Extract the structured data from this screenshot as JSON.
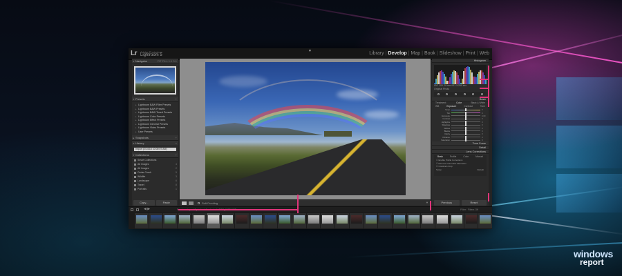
{
  "app": {
    "logo": "Lr",
    "brand_small": "Adobe Photoshop",
    "brand_name": "Lightroom 5"
  },
  "modules": [
    "Library",
    "Develop",
    "Map",
    "Book",
    "Slideshow",
    "Print",
    "Web"
  ],
  "active_module": "Develop",
  "left_panel": {
    "navigator": {
      "title": "Navigator",
      "zoom": "FIT  FILL  1:1  3:1"
    },
    "presets": {
      "title": "Presets",
      "items": [
        "Lightroom B&W Filter Presets",
        "Lightroom B&W Presets",
        "Lightroom B&W Toned Presets",
        "Lightroom Color Presets",
        "Lightroom Effect Presets",
        "Lightroom General Presets",
        "Lightroom Video Presets",
        "User Presets"
      ]
    },
    "snapshots": {
      "title": "Snapshots"
    },
    "history": {
      "title": "History",
      "entry": "Import (2/14/15 10:00:07 AM)"
    },
    "collections": {
      "title": "Collections",
      "items": [
        {
          "name": "Smart Collections",
          "count": ""
        },
        {
          "name": "All Images",
          "count": "4"
        },
        {
          "name": "All Images",
          "count": "2"
        },
        {
          "name": "Cedar Creek",
          "count": "5"
        },
        {
          "name": "Wildlife",
          "count": "3"
        },
        {
          "name": "Landscape",
          "count": "6"
        },
        {
          "name": "Travel",
          "count": "8"
        },
        {
          "name": "Portraits",
          "count": "1"
        }
      ]
    },
    "copy_label": "Copy...",
    "paste_label": "Paste"
  },
  "toolbar": {
    "soft_proofing": "Soft Proofing"
  },
  "right_panel": {
    "histogram_title": "Histogram",
    "histogram_info": "ISO 100   24 mm   f/11   1/250 sec",
    "original_photo": "Original Photo",
    "basic_title": "Basic",
    "treatment_label": "Treatment :",
    "treatment_options": [
      "Color",
      "Black & White"
    ],
    "basic_tabs": [
      "WB",
      "Exposure",
      "Contrast",
      "Tone"
    ],
    "sliders": [
      {
        "label": "Temp",
        "value": "0"
      },
      {
        "label": "Tint",
        "value": "0"
      },
      {
        "label": "Exposure",
        "value": "0.00"
      },
      {
        "label": "Contrast",
        "value": "0"
      },
      {
        "label": "Highlights",
        "value": "0"
      },
      {
        "label": "Shadows",
        "value": "0"
      },
      {
        "label": "Whites",
        "value": "0"
      },
      {
        "label": "Blacks",
        "value": "0"
      },
      {
        "label": "Clarity",
        "value": "0"
      },
      {
        "label": "Vibrance",
        "value": "0"
      },
      {
        "label": "Saturation",
        "value": "0"
      }
    ],
    "tone_curve_title": "Tone Curve",
    "detail_title": "Detail",
    "lens_title": "Lens Corrections",
    "lens_tabs": [
      "Basic",
      "Profile",
      "Color",
      "Manual"
    ],
    "lens_rows": [
      "Enable Profile Corrections",
      "Remove Chromatic Aberration",
      "Constrain Crop"
    ],
    "lens_setup": "Setup",
    "lens_default": "Default",
    "previous_label": "Previous",
    "reset_label": "Reset"
  },
  "filmstrip": {
    "info": "Previous Import   8 photos / 1 selected / DSC_0425.NEF",
    "filter": "Filter :",
    "filter_value": "Filters Off",
    "thumbnails": 25
  },
  "watermark": {
    "line1": "windows",
    "line2": "report"
  },
  "colors": {
    "annotation": "#e0357a",
    "panel": "#2b2b2b",
    "active_text": "#e6e6e6"
  }
}
